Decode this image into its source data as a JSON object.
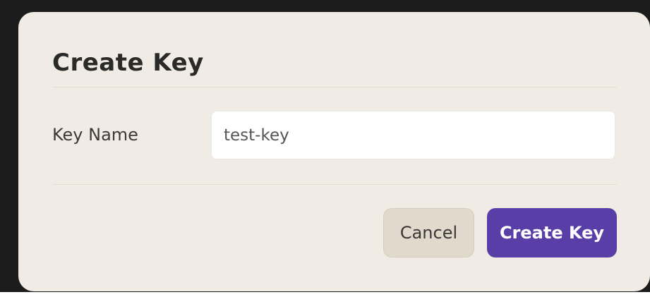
{
  "dialog": {
    "title": "Create Key",
    "field": {
      "label": "Key Name",
      "value": "test-key"
    },
    "buttons": {
      "cancel_label": "Cancel",
      "create_label": "Create Key"
    }
  },
  "colors": {
    "dialog_background": "#f0ece5",
    "backdrop": "#1c1c1c",
    "primary_button": "#5a3ea8",
    "secondary_button": "#e1d9cc"
  }
}
